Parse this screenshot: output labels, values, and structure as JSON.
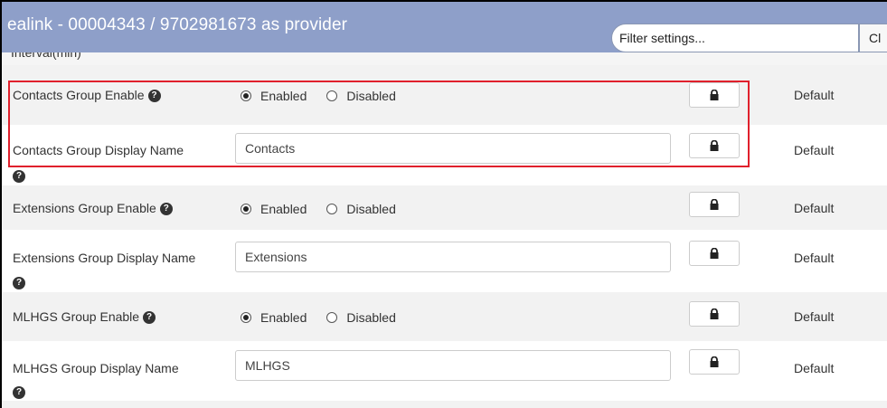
{
  "header": {
    "title": "ealink - 00004343 / 9702981673 as provider",
    "filter_placeholder": "Filter settings...",
    "clear_label": "Cl"
  },
  "clipped_row": {
    "label": "Interval(min)"
  },
  "rows": [
    {
      "label": "Contacts Group Enable",
      "type": "radio",
      "options": [
        "Enabled",
        "Disabled"
      ],
      "selected": "Enabled",
      "lock": "lock-icon",
      "default": "Default"
    },
    {
      "label": "Contacts Group Display Name",
      "type": "text",
      "value": "Contacts",
      "lock": "lock-icon",
      "default": "Default"
    },
    {
      "label": "Extensions Group Enable",
      "type": "radio",
      "options": [
        "Enabled",
        "Disabled"
      ],
      "selected": "Enabled",
      "lock": "lock-icon",
      "default": "Default"
    },
    {
      "label": "Extensions Group Display Name",
      "type": "text",
      "value": "Extensions",
      "lock": "lock-icon",
      "default": "Default"
    },
    {
      "label": "MLHGS Group Enable",
      "type": "radio",
      "options": [
        "Enabled",
        "Disabled"
      ],
      "selected": "Enabled",
      "lock": "lock-icon",
      "default": "Default"
    },
    {
      "label": "MLHGS Group Display Name",
      "type": "text",
      "value": "MLHGS",
      "lock": "lock-icon",
      "default": "Default"
    }
  ],
  "help_glyph": "?",
  "colors": {
    "header_bg": "#8e9fc9",
    "highlight": "#e0202c",
    "row_shade": "#f2f2f2"
  }
}
